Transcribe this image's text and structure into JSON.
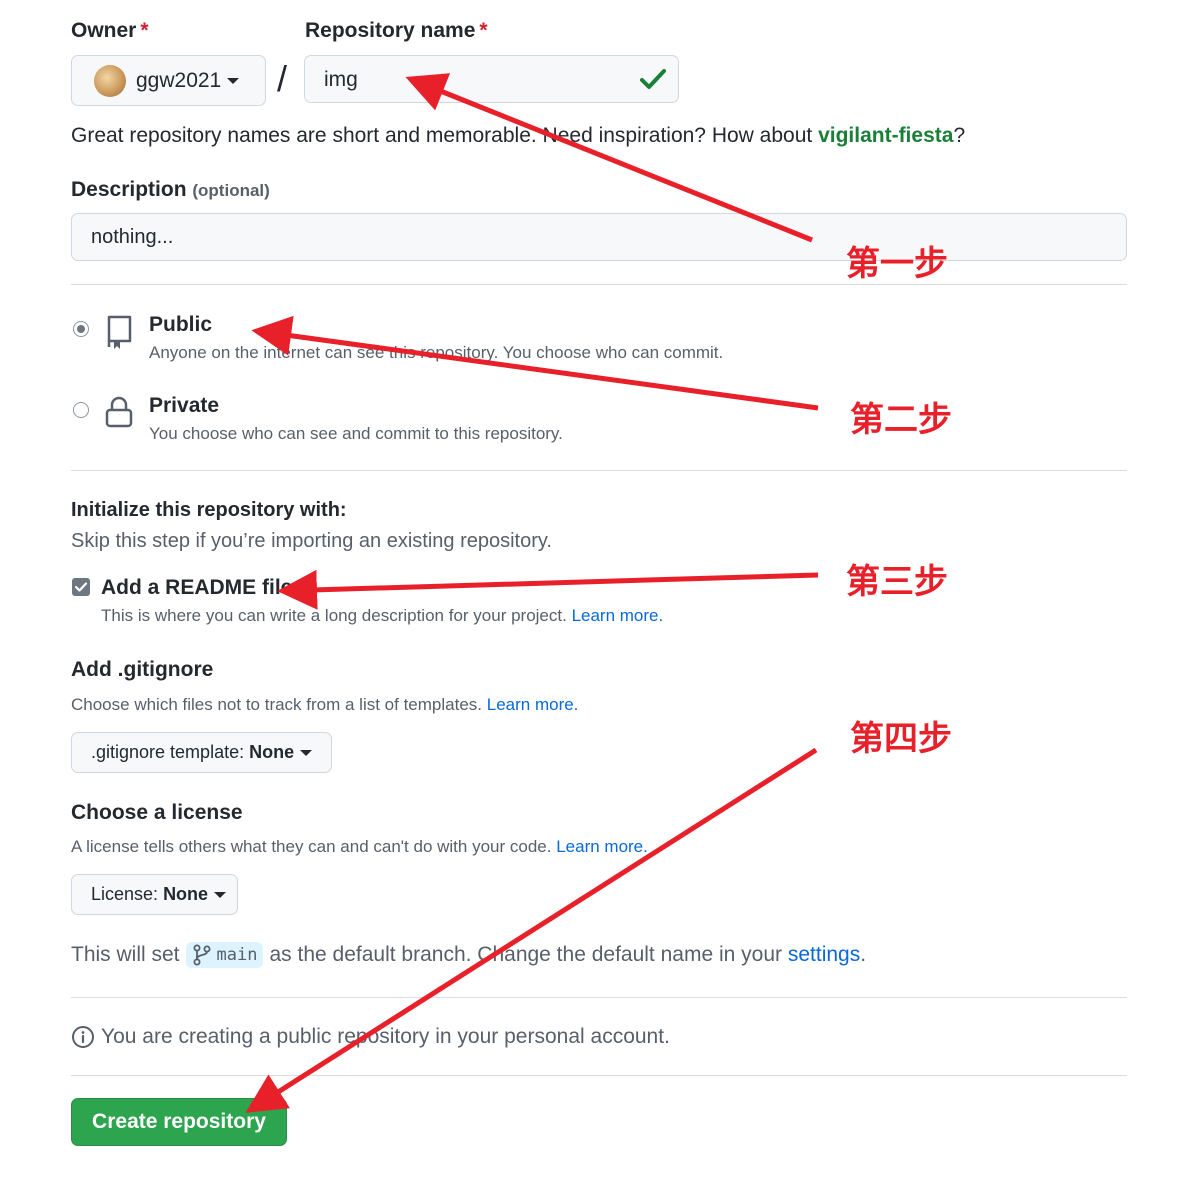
{
  "owner": {
    "label": "Owner",
    "required": "*",
    "username": "ggw2021"
  },
  "repo": {
    "label": "Repository name",
    "required": "*",
    "value": "img",
    "separator": "/"
  },
  "hint": {
    "text": "Great repository names are short and memorable. Need inspiration? How about ",
    "suggestion": "vigilant-fiesta",
    "end": "?"
  },
  "description": {
    "label": "Description",
    "optional": "(optional)",
    "value": "nothing..."
  },
  "visibility": {
    "public": {
      "title": "Public",
      "desc": "Anyone on the internet can see this repository. You choose who can commit."
    },
    "private": {
      "title": "Private",
      "desc": "You choose who can see and commit to this repository."
    }
  },
  "init": {
    "title": "Initialize this repository with:",
    "subtitle": "Skip this step if you’re importing an existing repository.",
    "readme_label": "Add a README file",
    "readme_desc": "This is where you can write a long description for your project.",
    "learn_more": "Learn more."
  },
  "gitignore": {
    "title": "Add .gitignore",
    "desc": "Choose which files not to track from a list of templates.",
    "learn_more": "Learn more.",
    "button_prefix": ".gitignore template:",
    "button_value": "None"
  },
  "license": {
    "title": "Choose a license",
    "desc": "A license tells others what they can and can't do with your code.",
    "learn_more": "Learn more.",
    "button_prefix": "License:",
    "button_value": "None"
  },
  "branch": {
    "pre": "This will set",
    "name": "main",
    "post": "as the default branch. Change the default name in your",
    "link": "settings",
    "end": "."
  },
  "notice": "You are creating a public repository in your personal account.",
  "create_button": "Create repository",
  "annotations": {
    "step1": "第一步",
    "step2": "第二步",
    "step3": "第三步",
    "step4": "第四步"
  },
  "colors": {
    "annotation": "#e8202a",
    "create_button": "#2da44e",
    "check": "#1a7f37",
    "suggestion": "#1a7f37",
    "link": "#0969da"
  }
}
